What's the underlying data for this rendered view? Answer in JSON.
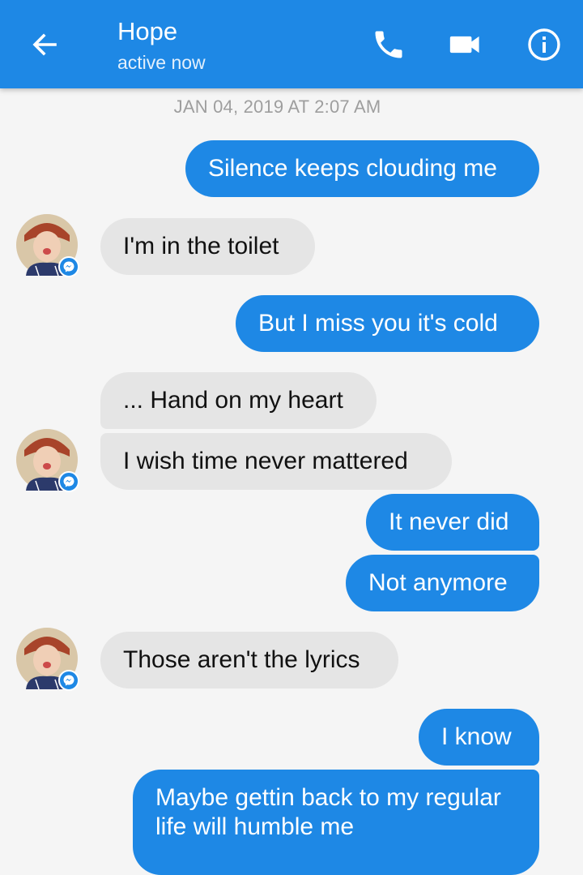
{
  "header": {
    "contact_name": "Hope",
    "status": "active now"
  },
  "timestamp": "JAN 04, 2019 AT 2:07 AM",
  "messages": [
    {
      "direction": "out",
      "text": "Silence keeps clouding me"
    },
    {
      "direction": "in",
      "text": "I'm in the toilet"
    },
    {
      "direction": "out",
      "text": "But I miss you it's cold"
    },
    {
      "direction": "in",
      "text": "... Hand on my heart"
    },
    {
      "direction": "in",
      "text": "I wish time never mattered"
    },
    {
      "direction": "out",
      "text": "It never did"
    },
    {
      "direction": "out",
      "text": "Not anymore"
    },
    {
      "direction": "in",
      "text": "Those aren't the lyrics"
    },
    {
      "direction": "out",
      "text": "I know"
    },
    {
      "direction": "out",
      "text": "Maybe gettin back to my regular life will humble me"
    }
  ],
  "colors": {
    "header": "#1e88e5",
    "outgoing_bubble": "#1e88e5",
    "incoming_bubble": "#e5e5e5",
    "background": "#f5f5f5"
  },
  "icons": [
    "back-arrow-icon",
    "phone-icon",
    "video-camera-icon",
    "info-icon",
    "messenger-badge-icon"
  ]
}
